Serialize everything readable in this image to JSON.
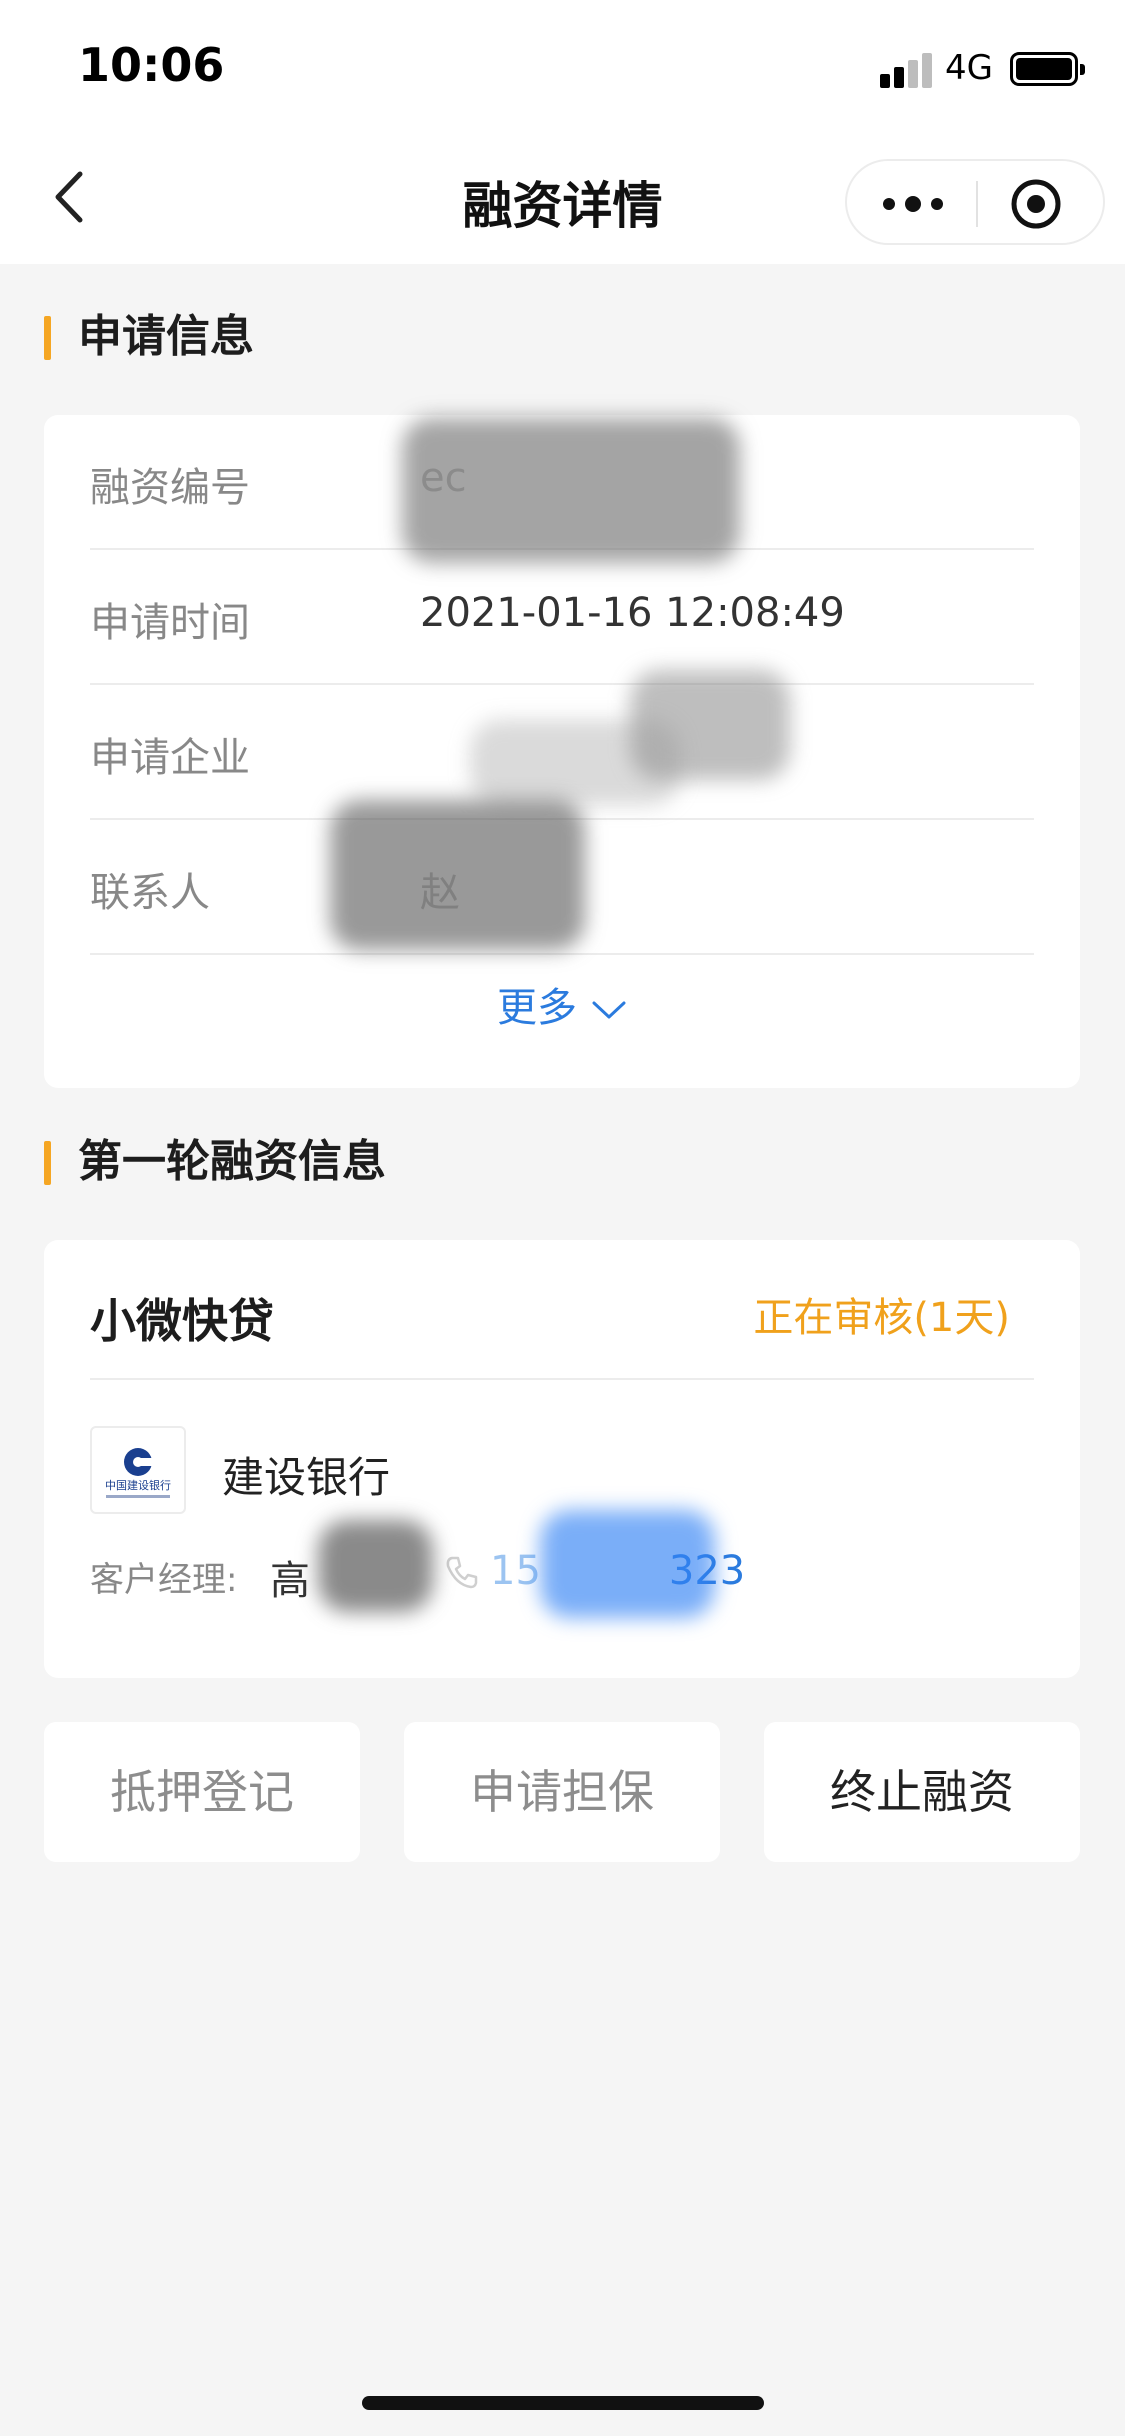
{
  "status_bar": {
    "time": "10:06",
    "network": "4G",
    "signal_bars_active": 2,
    "battery_level": 0.95
  },
  "nav": {
    "title": "融资详情",
    "back_icon": "chevron-left-icon",
    "more_icon": "more-dots-icon",
    "close_icon": "target-icon"
  },
  "section_application": {
    "title": "申请信息",
    "rows": [
      {
        "label": "融资编号",
        "value": "ec",
        "redacted": true
      },
      {
        "label": "申请时间",
        "value": "2021-01-16 12:08:49",
        "redacted": false
      },
      {
        "label": "申请企业",
        "value": "",
        "redacted": true
      },
      {
        "label": "联系人",
        "value": "赵",
        "redacted": true
      }
    ],
    "more_label": "更多",
    "more_icon": "chevron-down-icon"
  },
  "section_round": {
    "title": "第一轮融资信息",
    "product_name": "小微快贷",
    "status": "正在审核(1天)",
    "bank_name": "建设银行",
    "bank_logo_text": "中国建设银行",
    "manager_label": "客户经理:",
    "manager_name": "高",
    "phone_prefix": "15",
    "phone_suffix": "323",
    "phone_icon": "phone-icon"
  },
  "actions": {
    "mortgage": "抵押登记",
    "guarantee": "申请担保",
    "terminate": "终止融资"
  },
  "colors": {
    "accent": "#f5a623",
    "link": "#2b7bde",
    "status": "#f0a11c",
    "background": "#f5f5f5"
  }
}
